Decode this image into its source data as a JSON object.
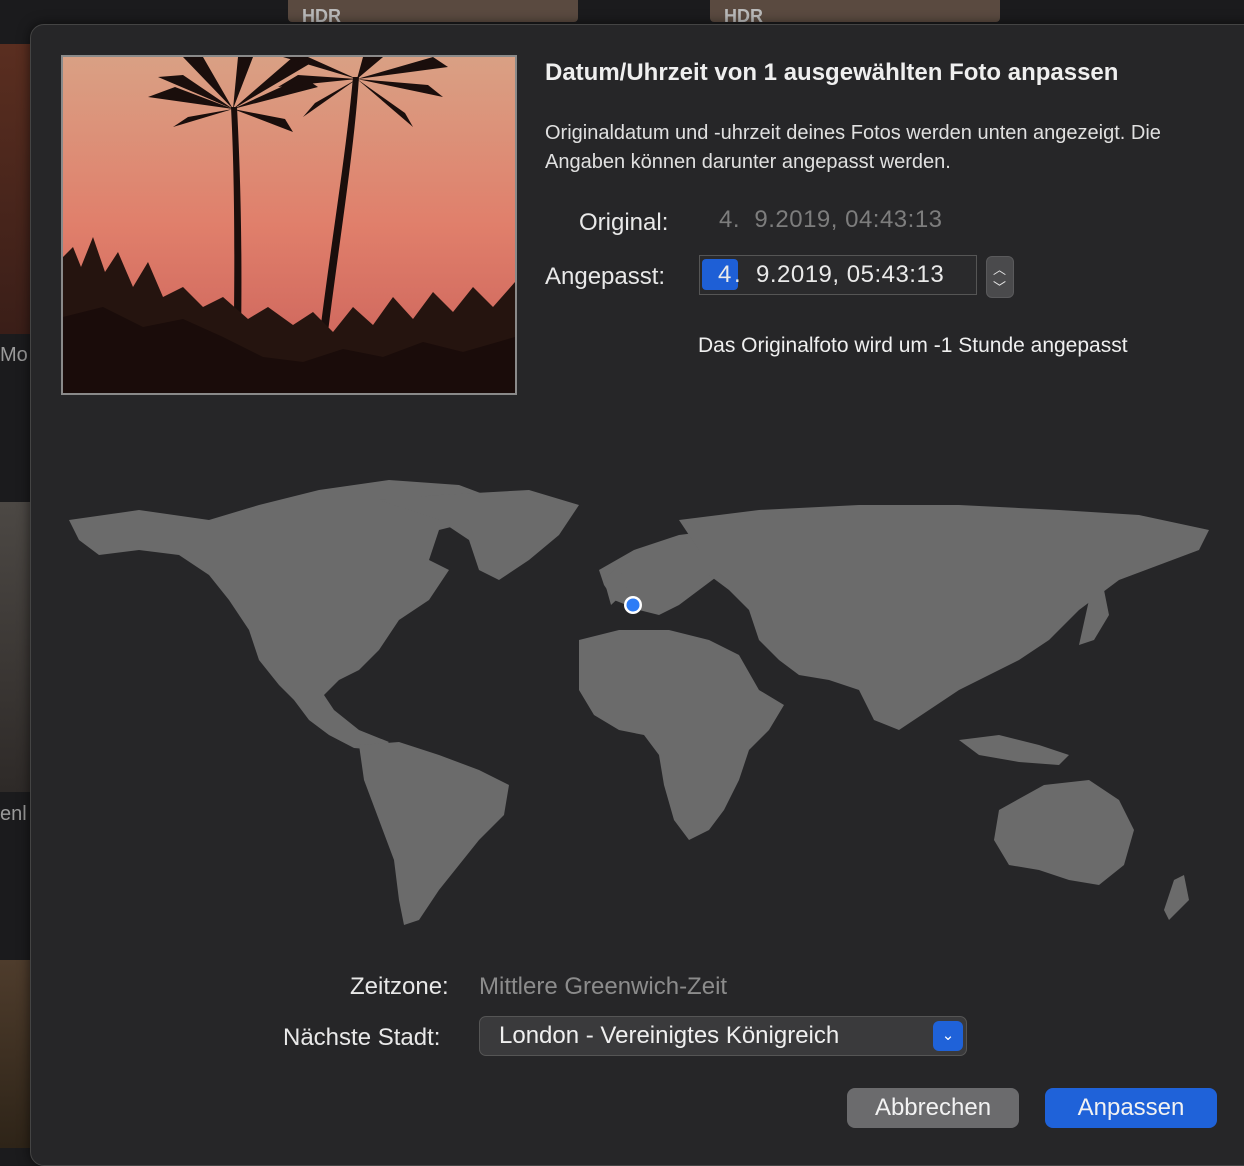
{
  "background": {
    "top_badge_1": "HDR",
    "top_badge_2": "HDR",
    "side_label_1": "Mo",
    "side_label_2": "enl"
  },
  "dialog": {
    "title": "Datum/Uhrzeit von 1 ausgewählten Foto anpassen",
    "description": "Originaldatum und -uhrzeit deines Fotos werden unten angezeigt. Die Angaben können darunter angepasst werden.",
    "original_label": "Original:",
    "original_value": "4.  9.2019, 04:43:13",
    "adjusted_label": "Angepasst:",
    "adjusted_day": "4",
    "adjusted_rest": "9.2019, 05:43:13",
    "adjust_note": "Das Originalfoto wird um -1 Stunde angepasst",
    "timezone_label": "Zeitzone:",
    "timezone_value": "Mittlere Greenwich-Zeit",
    "city_label": "Nächste Stadt:",
    "city_value": "London - Vereinigtes Königreich",
    "cancel_label": "Abbrechen",
    "ok_label": "Anpassen"
  },
  "colors": {
    "accent": "#1f62d9",
    "map_land": "#6b6b6b",
    "location_dot": "#2d7cf6"
  }
}
